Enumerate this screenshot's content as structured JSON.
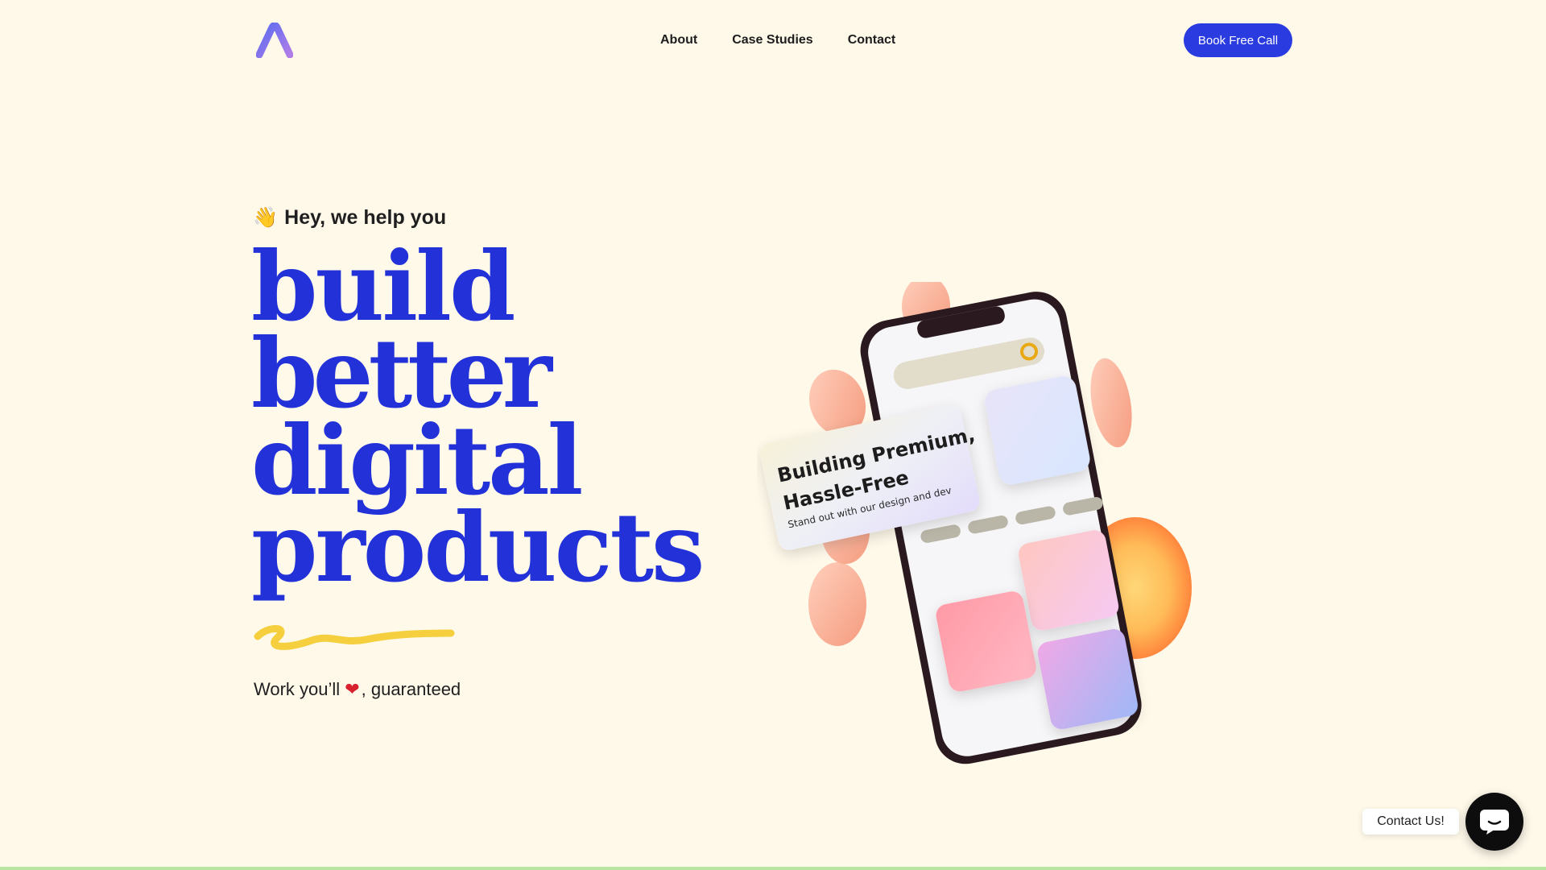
{
  "header": {
    "logo_icon": "agency-a-logo-icon",
    "nav": [
      {
        "label": "About"
      },
      {
        "label": "Case Studies"
      },
      {
        "label": "Contact"
      }
    ],
    "cta_label": "Book Free Call"
  },
  "hero": {
    "eyebrow_emoji": "👋",
    "eyebrow_text": "Hey, we help you",
    "headline": {
      "line1": "build",
      "line2": "better",
      "line3": "digital",
      "line4": "products"
    },
    "subline_before": "Work you’ll",
    "subline_heart": "❤",
    "subline_after": ", guaranteed"
  },
  "illustration": {
    "card_title_line1": "Building Premium,",
    "card_title_line2": "Hassle-Free",
    "card_subtitle": "Stand out with our design and dev"
  },
  "chat": {
    "label": "Contact Us!",
    "icon": "chat-bubble-icon"
  },
  "colors": {
    "background": "#fff9ea",
    "accent": "#2a3be0",
    "headline": "#2332d8",
    "squiggle": "#f5cf3d"
  }
}
